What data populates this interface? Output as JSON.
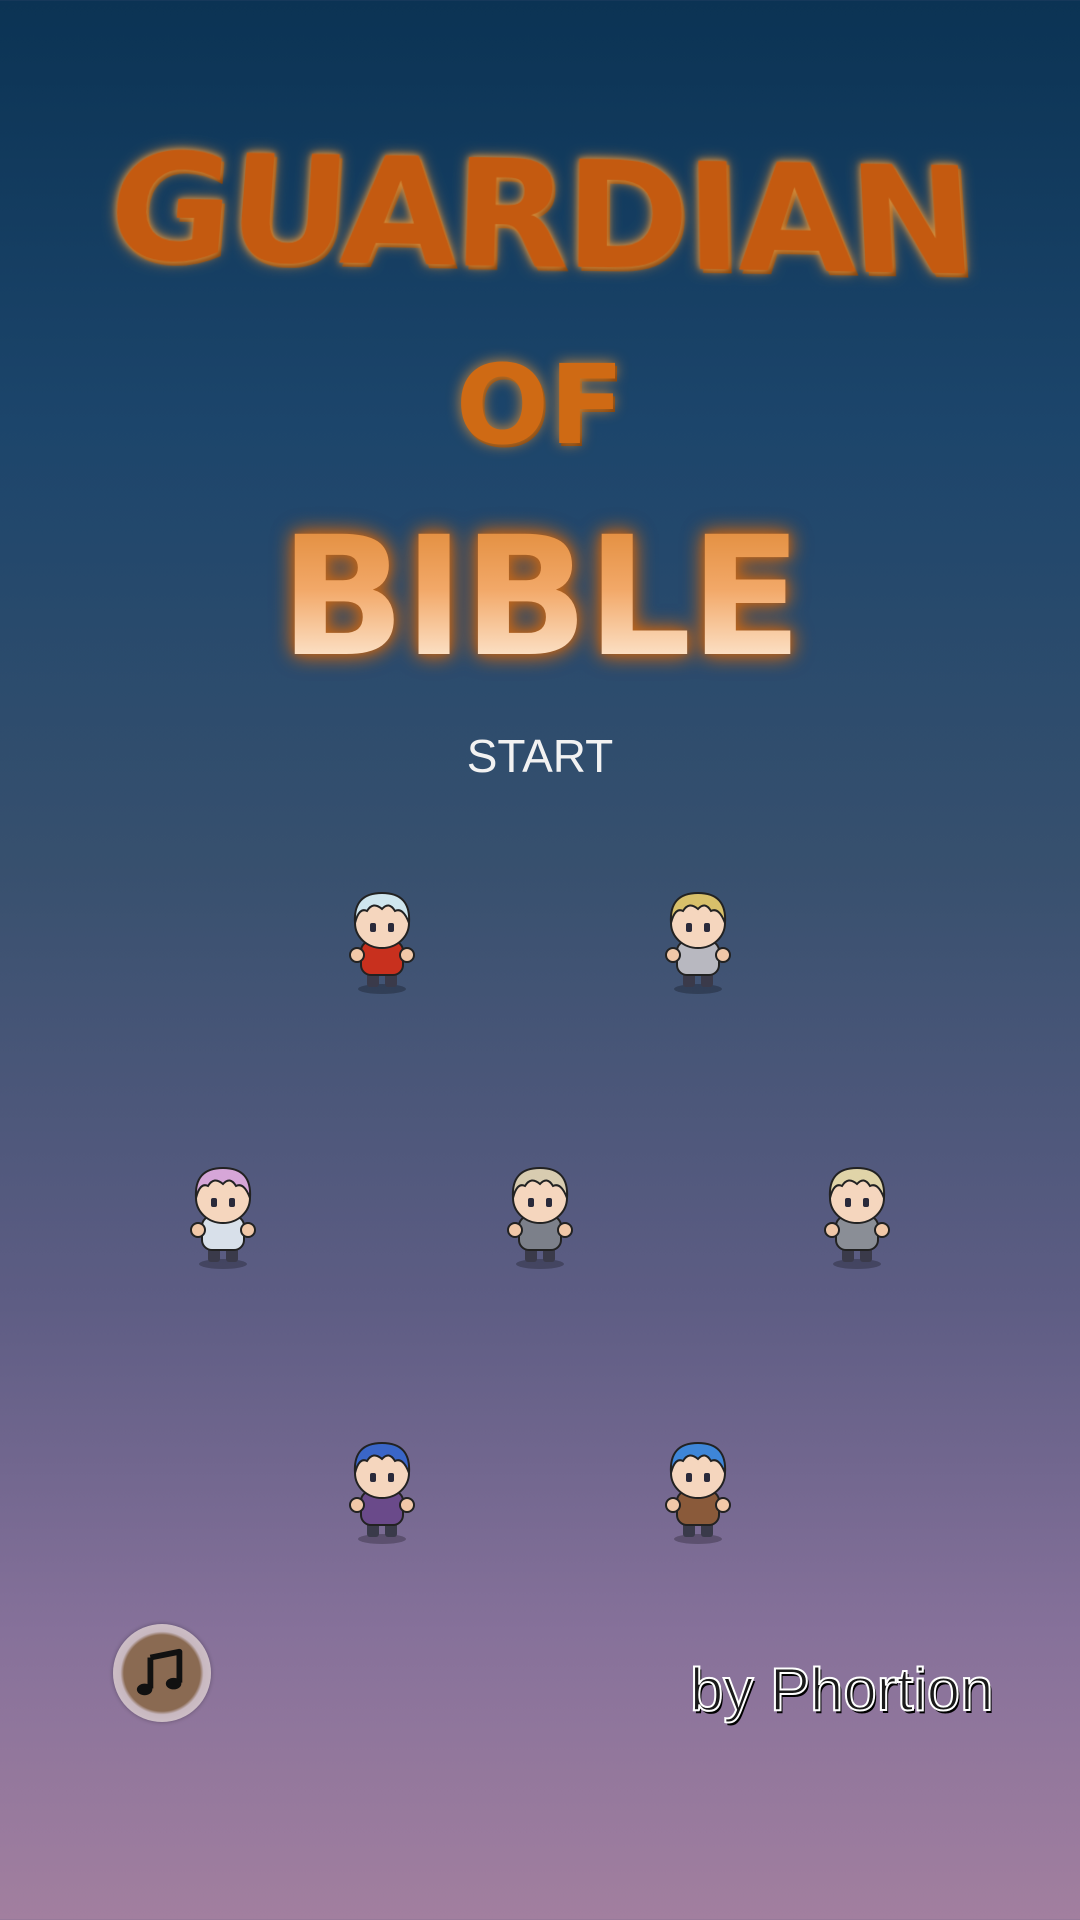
{
  "title": {
    "line1": "GUARDIAN",
    "line2": "OF",
    "line3": "BIBLE"
  },
  "menu": {
    "start_label": "START"
  },
  "characters": [
    {
      "name": "silver-haired-red-armor",
      "hair": "#cfe6ee",
      "body": "#c8301e"
    },
    {
      "name": "blonde-elf-knight",
      "hair": "#d8c06a",
      "body": "#b8b8c0"
    },
    {
      "name": "pink-haired-mage",
      "hair": "#d6a6d8",
      "body": "#d8e0ea"
    },
    {
      "name": "grey-haired-swordsman",
      "hair": "#d8ccb0",
      "body": "#7c808a"
    },
    {
      "name": "blonde-girl",
      "hair": "#e0d4a8",
      "body": "#8a8e96"
    },
    {
      "name": "blue-haired-sorceress",
      "hair": "#3a66c8",
      "body": "#6a4a8a"
    },
    {
      "name": "blue-haired-warrior",
      "hair": "#3e86d8",
      "body": "#8a5a3a"
    }
  ],
  "footer": {
    "music_icon": "music-note-icon",
    "credit": "by Phortion"
  },
  "colors": {
    "title_orange": "#c45a10",
    "bg_top": "#0b3354",
    "bg_bottom": "#a27f9f"
  }
}
